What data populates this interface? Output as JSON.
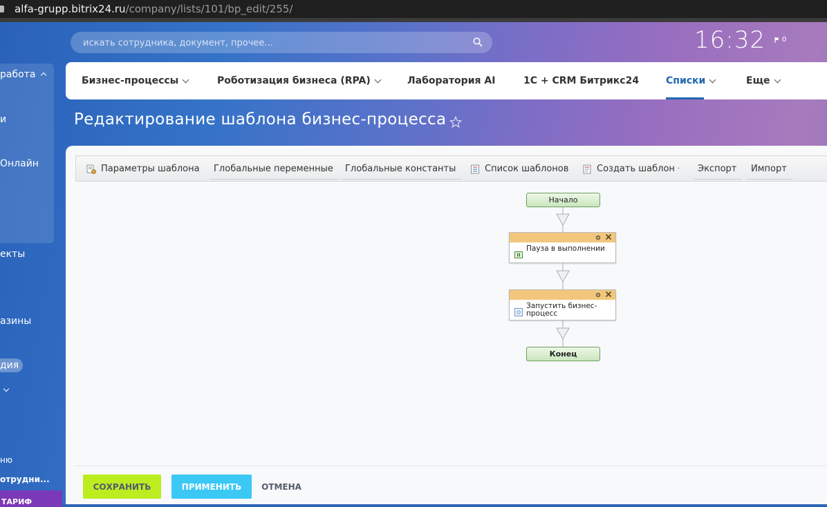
{
  "browser": {
    "host": "alfa-grupp.bitrix24.ru",
    "path": "/company/lists/101/bp_edit/255/"
  },
  "sidebar": {
    "items": [
      {
        "label": "работа"
      },
      {
        "label": "и"
      },
      {
        "label": "Онлайн"
      },
      {
        "label": "екты"
      },
      {
        "label": "азины"
      },
      {
        "label": "дия"
      },
      {
        "label": "ню"
      },
      {
        "label": "отрудни..."
      },
      {
        "label": "ТАРИФ"
      }
    ]
  },
  "header": {
    "search_placeholder": "искать сотрудника, документ, прочее...",
    "clock": "16:32",
    "notif_count": "0"
  },
  "nav": {
    "items": [
      {
        "label": "Бизнес-процессы"
      },
      {
        "label": "Роботизация бизнеса (RPA)"
      },
      {
        "label": "Лаборатория AI"
      },
      {
        "label": "1С + CRM Битрикс24"
      },
      {
        "label": "Списки"
      },
      {
        "label": "Еще"
      }
    ]
  },
  "page": {
    "title": "Редактирование шаблона бизнес-процесса"
  },
  "toolbar": {
    "items": [
      {
        "label": "Параметры шаблона"
      },
      {
        "label": "Глобальные переменные"
      },
      {
        "label": "Глобальные константы"
      },
      {
        "label": "Список шаблонов"
      },
      {
        "label": "Создать шаблон"
      },
      {
        "label": "Экспорт"
      },
      {
        "label": "Импорт"
      }
    ]
  },
  "diagram": {
    "start": "Начало",
    "activities": [
      {
        "label": "Пауза в выполнении"
      },
      {
        "label": "Запустить бизнес-процесс"
      }
    ],
    "end": "Конец"
  },
  "footer": {
    "save": "СОХРАНИТЬ",
    "apply": "ПРИМЕНИТЬ",
    "cancel": "ОТМЕНА"
  }
}
